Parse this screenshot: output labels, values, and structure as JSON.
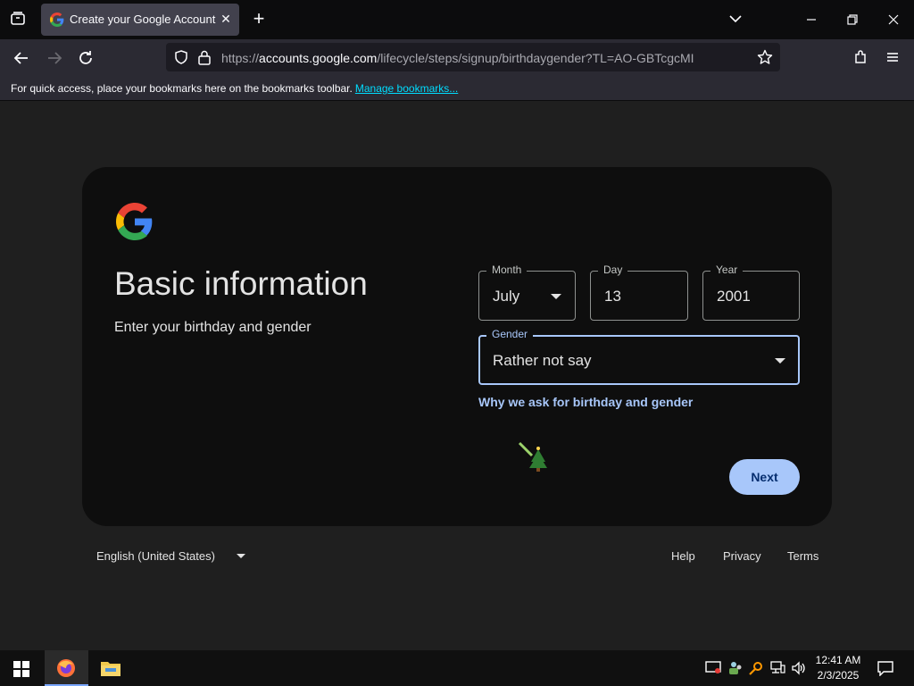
{
  "browser": {
    "tab_title": "Create your Google Account",
    "tab_close": "✕",
    "new_tab": "+",
    "url_domain": "accounts.google.com",
    "url_prefix": "https://",
    "url_path": "/lifecycle/steps/signup/birthdaygender?TL=AO-GBTcgcMINubiBLwCV",
    "bookmarks_text": "For quick access, place your bookmarks here on the bookmarks toolbar.",
    "bookmarks_link": "Manage bookmarks..."
  },
  "page": {
    "title": "Basic information",
    "subtitle": "Enter your birthday and gender",
    "month_label": "Month",
    "month_value": "July",
    "day_label": "Day",
    "day_value": "13",
    "year_label": "Year",
    "year_value": "2001",
    "gender_label": "Gender",
    "gender_value": "Rather not say",
    "why_link": "Why we ask for birthday and gender",
    "next_button": "Next"
  },
  "footer": {
    "language": "English (United States)",
    "help": "Help",
    "privacy": "Privacy",
    "terms": "Terms"
  },
  "taskbar": {
    "time": "12:41 AM",
    "date": "2/3/2025"
  },
  "colors": {
    "accent": "#a8c7fa",
    "card_bg": "#0e0e0e",
    "page_bg": "#1f1f1f"
  }
}
